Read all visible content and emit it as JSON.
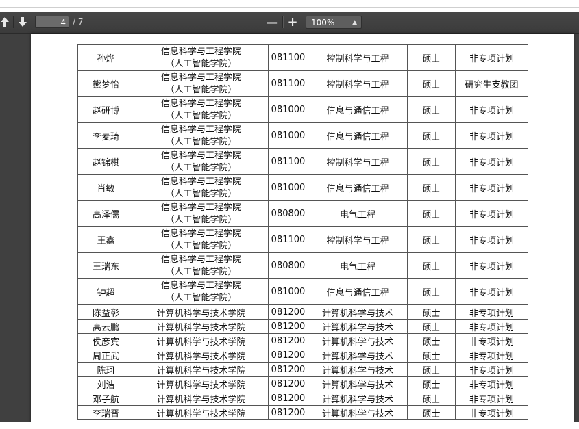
{
  "toolbar": {
    "page_number": "4",
    "page_total": "/ 7",
    "zoom_out": "—",
    "zoom_in": "+",
    "zoom_level": "100%"
  },
  "table": {
    "rows": [
      {
        "name": "孙烨",
        "dept_line1": "信息科学与工程学院",
        "dept_line2": "（人工智能学院）",
        "code": "081100",
        "major": "控制科学与工程",
        "degree": "硕士",
        "plan": "非专项计划"
      },
      {
        "name": "熊梦怡",
        "dept_line1": "信息科学与工程学院",
        "dept_line2": "（人工智能学院）",
        "code": "081100",
        "major": "控制科学与工程",
        "degree": "硕士",
        "plan": "研究生支教团"
      },
      {
        "name": "赵研博",
        "dept_line1": "信息科学与工程学院",
        "dept_line2": "（人工智能学院）",
        "code": "081000",
        "major": "信息与通信工程",
        "degree": "硕士",
        "plan": "非专项计划"
      },
      {
        "name": "李麦琦",
        "dept_line1": "信息科学与工程学院",
        "dept_line2": "（人工智能学院）",
        "code": "081000",
        "major": "信息与通信工程",
        "degree": "硕士",
        "plan": "非专项计划"
      },
      {
        "name": "赵锦棋",
        "dept_line1": "信息科学与工程学院",
        "dept_line2": "（人工智能学院）",
        "code": "081100",
        "major": "控制科学与工程",
        "degree": "硕士",
        "plan": "非专项计划"
      },
      {
        "name": "肖敏",
        "dept_line1": "信息科学与工程学院",
        "dept_line2": "（人工智能学院）",
        "code": "081000",
        "major": "信息与通信工程",
        "degree": "硕士",
        "plan": "非专项计划"
      },
      {
        "name": "高泽儒",
        "dept_line1": "信息科学与工程学院",
        "dept_line2": "（人工智能学院）",
        "code": "080800",
        "major": "电气工程",
        "degree": "硕士",
        "plan": "非专项计划"
      },
      {
        "name": "王鑫",
        "dept_line1": "信息科学与工程学院",
        "dept_line2": "（人工智能学院）",
        "code": "081100",
        "major": "控制科学与工程",
        "degree": "硕士",
        "plan": "非专项计划"
      },
      {
        "name": "王瑞东",
        "dept_line1": "信息科学与工程学院",
        "dept_line2": "（人工智能学院）",
        "code": "080800",
        "major": "电气工程",
        "degree": "硕士",
        "plan": "非专项计划"
      },
      {
        "name": "钟超",
        "dept_line1": "信息科学与工程学院",
        "dept_line2": "（人工智能学院）",
        "code": "081000",
        "major": "信息与通信工程",
        "degree": "硕士",
        "plan": "非专项计划"
      },
      {
        "name": "陈益彰",
        "dept_line1": "计算机科学与技术学院",
        "dept_line2": "",
        "code": "081200",
        "major": "计算机科学与技术",
        "degree": "硕士",
        "plan": "非专项计划"
      },
      {
        "name": "高云鹏",
        "dept_line1": "计算机科学与技术学院",
        "dept_line2": "",
        "code": "081200",
        "major": "计算机科学与技术",
        "degree": "硕士",
        "plan": "非专项计划"
      },
      {
        "name": "侯彦宾",
        "dept_line1": "计算机科学与技术学院",
        "dept_line2": "",
        "code": "081200",
        "major": "计算机科学与技术",
        "degree": "硕士",
        "plan": "非专项计划"
      },
      {
        "name": "周正武",
        "dept_line1": "计算机科学与技术学院",
        "dept_line2": "",
        "code": "081200",
        "major": "计算机科学与技术",
        "degree": "硕士",
        "plan": "非专项计划"
      },
      {
        "name": "陈珂",
        "dept_line1": "计算机科学与技术学院",
        "dept_line2": "",
        "code": "081200",
        "major": "计算机科学与技术",
        "degree": "硕士",
        "plan": "非专项计划"
      },
      {
        "name": "刘浩",
        "dept_line1": "计算机科学与技术学院",
        "dept_line2": "",
        "code": "081200",
        "major": "计算机科学与技术",
        "degree": "硕士",
        "plan": "非专项计划"
      },
      {
        "name": "邓子航",
        "dept_line1": "计算机科学与技术学院",
        "dept_line2": "",
        "code": "081200",
        "major": "计算机科学与技术",
        "degree": "硕士",
        "plan": "非专项计划"
      },
      {
        "name": "李瑞晋",
        "dept_line1": "计算机科学与技术学院",
        "dept_line2": "",
        "code": "081200",
        "major": "计算机科学与技术",
        "degree": "硕士",
        "plan": "非专项计划"
      }
    ]
  }
}
